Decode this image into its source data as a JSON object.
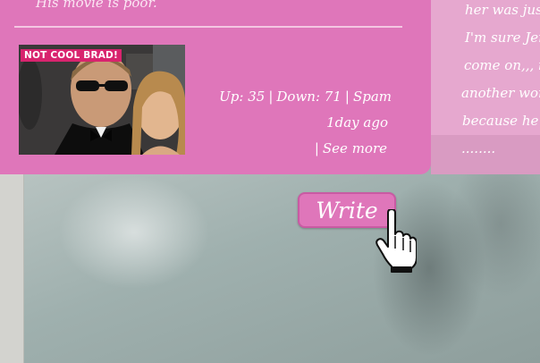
{
  "previous_comment": {
    "text": "His movie is poor."
  },
  "post": {
    "thumbnail_caption": "NOT COOL BRAD!",
    "votes": {
      "up_label": "Up:",
      "up_count": "35",
      "separator": "|",
      "down_label": "Down:",
      "down_count": "71",
      "spam_label": "Spam"
    },
    "posted_time": "1day ago",
    "see_more_label": "See more"
  },
  "side_comment": {
    "lines": [
      "her was just a",
      "I'm sure Jenni",
      "come on,,, if",
      "another woma",
      "because he no",
      "........"
    ]
  },
  "actions": {
    "write_label": "Write"
  },
  "colors": {
    "panel_pink": "#df76ba",
    "side_pink": "#e6a8cf",
    "caption_red": "#d8246e"
  }
}
